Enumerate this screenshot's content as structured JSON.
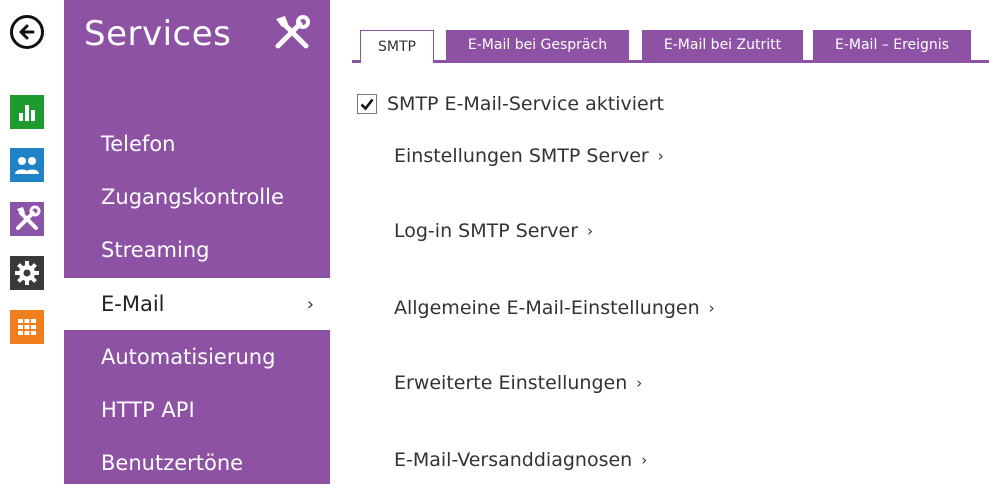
{
  "rail": {
    "icons": [
      "back-arrow-icon",
      "bar-chart-icon",
      "users-icon",
      "tools-icon",
      "gear-icon",
      "grid-icon"
    ],
    "colors": {
      "status": "#1e9b2f",
      "directory": "#1f83c6",
      "services": "#8a55a8",
      "hardware": "#3a3a3a",
      "system": "#f07e1d"
    }
  },
  "sidebar": {
    "title": "Services",
    "accent": "#8d52a3",
    "items": [
      {
        "label": "Telefon"
      },
      {
        "label": "Zugangskontrolle"
      },
      {
        "label": "Streaming"
      },
      {
        "label": "E-Mail",
        "active": true,
        "arrow": "›"
      },
      {
        "label": "Automatisierung"
      },
      {
        "label": "HTTP API"
      },
      {
        "label": "Benutzertöne"
      }
    ]
  },
  "tabs": [
    {
      "label": "SMTP",
      "active": true
    },
    {
      "label": "E-Mail bei Gespräch"
    },
    {
      "label": "E-Mail bei Zutritt"
    },
    {
      "label": "E-Mail – Ereignis"
    }
  ],
  "main": {
    "smtp_enabled": {
      "label": "SMTP E-Mail-Service aktiviert",
      "checked": true
    },
    "sections": [
      {
        "label": "Einstellungen SMTP Server",
        "chevron": "›"
      },
      {
        "label": "Log-in SMTP Server",
        "chevron": "›"
      },
      {
        "label": "Allgemeine E-Mail-Einstellungen",
        "chevron": "›"
      },
      {
        "label": "Erweiterte Einstellungen",
        "chevron": "›"
      },
      {
        "label": "E-Mail-Versanddiagnosen",
        "chevron": "›"
      }
    ]
  }
}
